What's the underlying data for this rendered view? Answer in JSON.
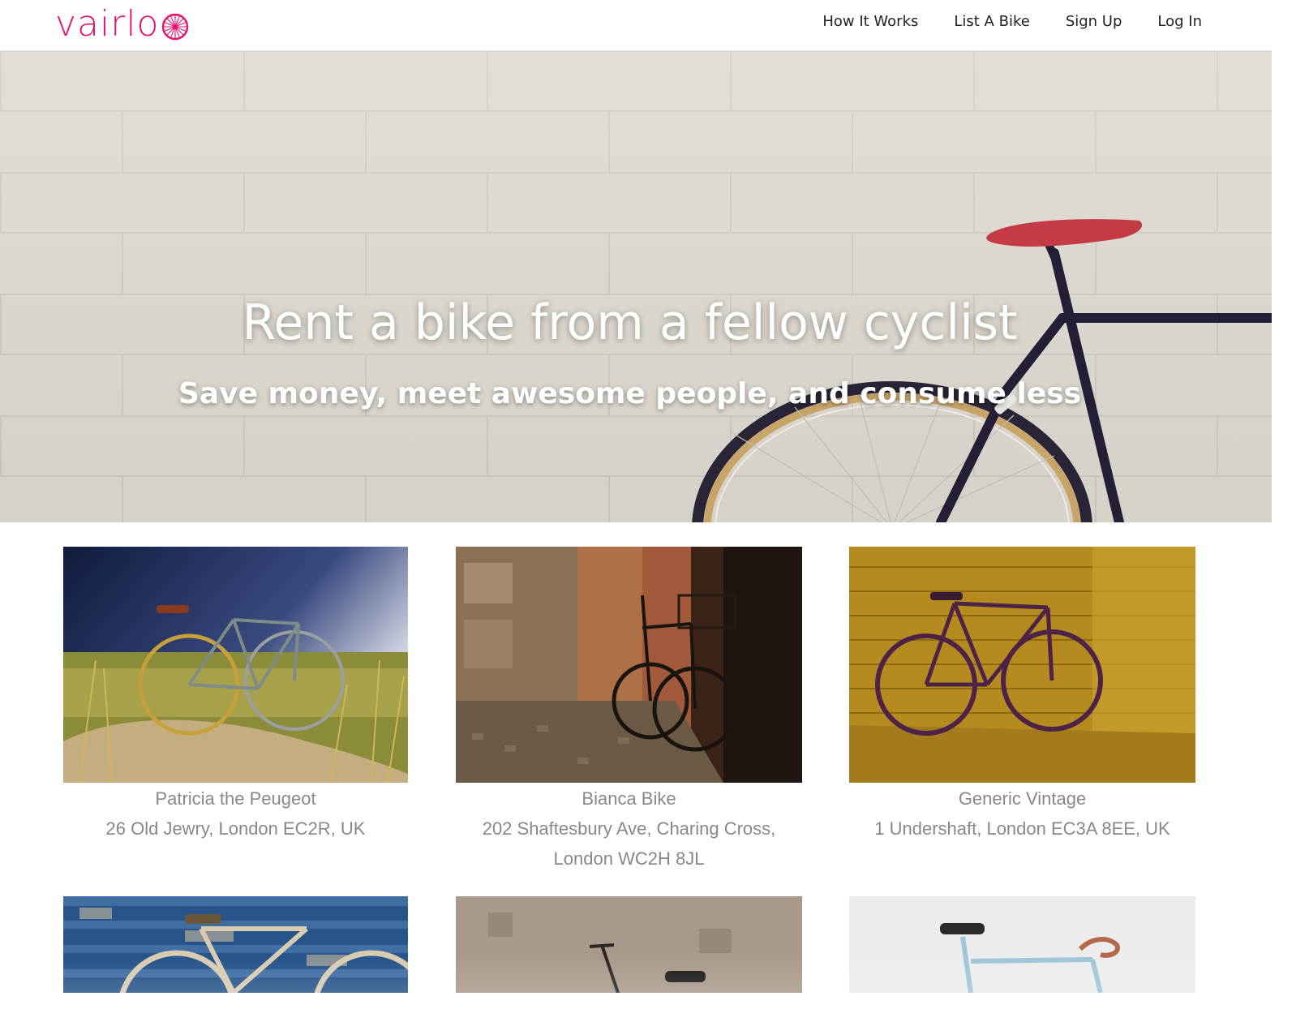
{
  "brand": {
    "name": "vairlo",
    "color": "#e5146f"
  },
  "nav": {
    "links": [
      "How It Works",
      "List A Bike",
      "Sign Up",
      "Log In"
    ]
  },
  "hero": {
    "title": "Rent a bike from a fellow cyclist",
    "subtitle": "Save money, meet awesome people, and consume less"
  },
  "listings": [
    {
      "title": "Patricia the Peugeot",
      "address": "26 Old Jewry, London EC2R, UK"
    },
    {
      "title": "Bianca Bike",
      "address": "202 Shaftesbury Ave, Charing Cross, London WC2H 8JL"
    },
    {
      "title": "Generic Vintage",
      "address": "1 Undershaft, London EC3A 8EE, UK"
    },
    {
      "title": "",
      "address": ""
    },
    {
      "title": "",
      "address": ""
    },
    {
      "title": "",
      "address": ""
    }
  ]
}
